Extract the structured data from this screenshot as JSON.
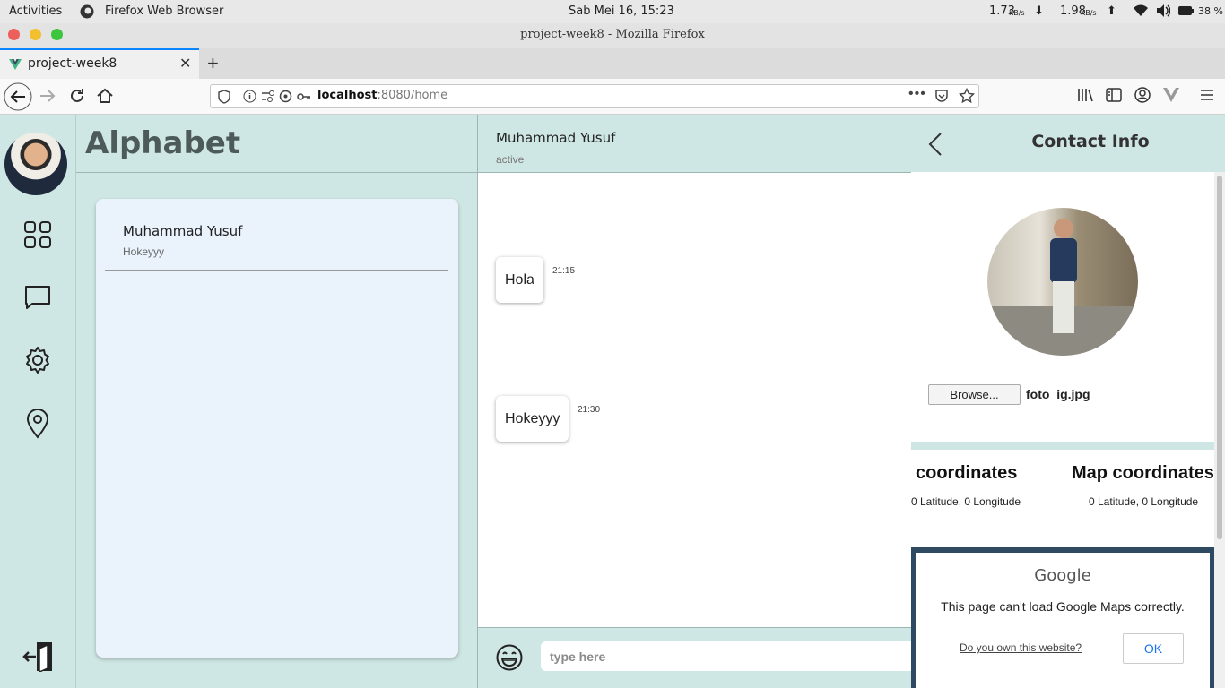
{
  "system": {
    "activities": "Activities",
    "app_name": "Firefox Web Browser",
    "clock": "Sab Mei 16, 15:23",
    "net_down_value": "1.73",
    "net_down_unit": "KB/s",
    "net_up_value": "1.98",
    "net_up_unit": "KB/s",
    "battery": "38 %"
  },
  "browser": {
    "window_title": "project-week8  -  Mozilla  Firefox",
    "tab_title": "project-week8",
    "url_host": "localhost",
    "url_path": ":8080/home"
  },
  "sidebar": {
    "items": [
      "dashboard-icon",
      "chat-icon",
      "settings-icon",
      "location-icon"
    ],
    "logout": "logout-icon"
  },
  "contacts": {
    "title": "Alphabet",
    "items": [
      {
        "name": "Muhammad Yusuf",
        "last_message": "Hokeyyy"
      }
    ]
  },
  "chat": {
    "contact_name": "Muhammad Yusuf",
    "status": "active",
    "messages": [
      {
        "text": "Hola",
        "time": "21:15"
      },
      {
        "text": "Hokeyyy",
        "time": "21:30"
      }
    ],
    "input_placeholder": "type here"
  },
  "contact_info": {
    "title": "Contact Info",
    "browse_label": "Browse...",
    "file_name": "foto_ig.jpg",
    "coords": [
      {
        "heading": "coordinates",
        "value": "0 Latitude, 0 Longitude"
      },
      {
        "heading": "Map coordinates",
        "value": "0 Latitude, 0 Longitude"
      }
    ],
    "map_error": {
      "brand": "Google",
      "message": "This page can't load Google Maps correctly.",
      "link": "Do you own this website?",
      "ok": "OK"
    }
  },
  "colors": {
    "accent": "#cfe7e4",
    "card": "#eaf2fc",
    "firefox_blue": "#0a84ff",
    "map_frame": "#2e4a63"
  }
}
